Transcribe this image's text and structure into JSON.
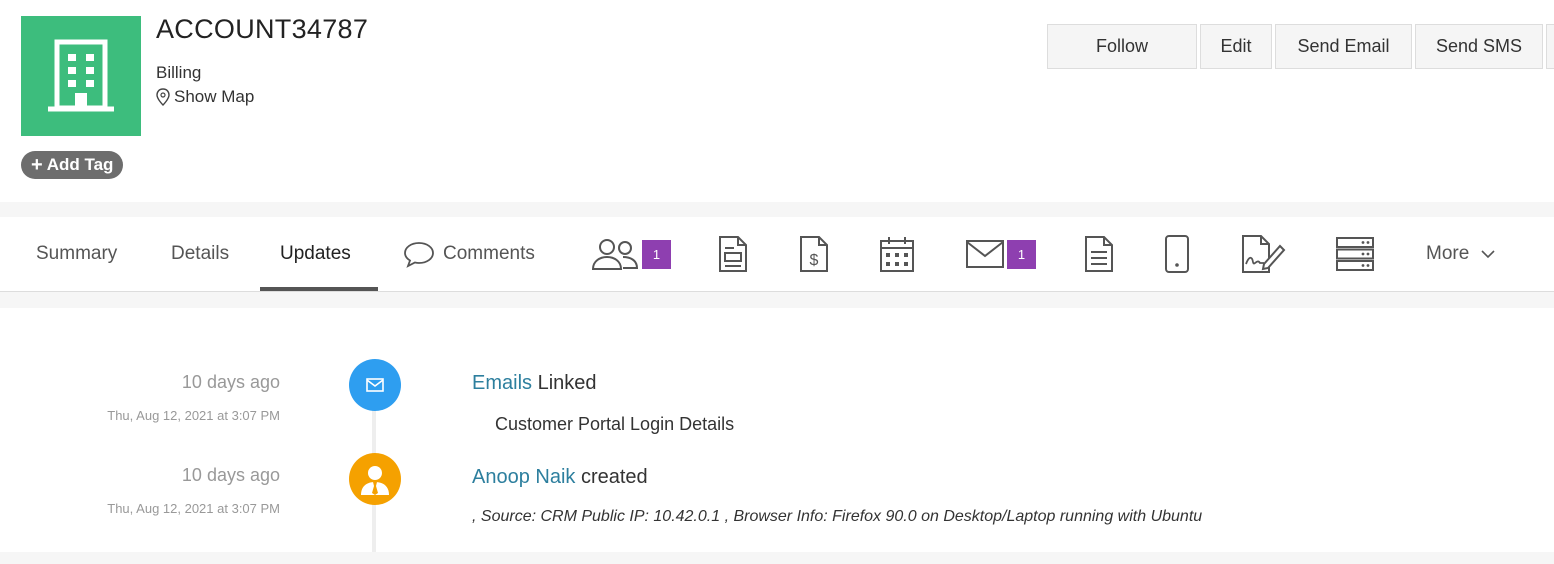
{
  "account": {
    "name": "ACCOUNT34787",
    "subtitle": "Billing",
    "show_map": "Show Map",
    "add_tag": "Add Tag",
    "avatar_icon": "building-icon",
    "avatar_color": "#3dbd7d"
  },
  "actions": {
    "follow": "Follow",
    "edit": "Edit",
    "send_email": "Send Email",
    "send_sms": "Send SMS"
  },
  "tabs": {
    "summary": "Summary",
    "details": "Details",
    "updates": "Updates",
    "comments": "Comments",
    "contacts_count": "1",
    "emails_count": "1",
    "more": "More",
    "active": "Updates"
  },
  "icons": [
    "contacts-icon",
    "quotes-icon",
    "invoices-icon",
    "calendar-icon",
    "email-icon",
    "document-icon",
    "mobile-icon",
    "signature-icon",
    "server-icon"
  ],
  "updates": [
    {
      "relative": "10 days ago",
      "absolute": "Thu, Aug 12, 2021 at 3:07 PM",
      "link": "Emails",
      "action": "Linked",
      "detail": "Customer Portal Login Details",
      "icon": "email-icon",
      "color": "#2e9ef0"
    },
    {
      "relative": "10 days ago",
      "absolute": "Thu, Aug 12, 2021 at 3:07 PM",
      "link": "Anoop Naik",
      "action": "created",
      "detail": ", Source: CRM Public IP: 10.42.0.1 , Browser Info: Firefox 90.0 on Desktop/Laptop running with Ubuntu",
      "icon": "user-icon",
      "color": "#f5a100"
    }
  ]
}
